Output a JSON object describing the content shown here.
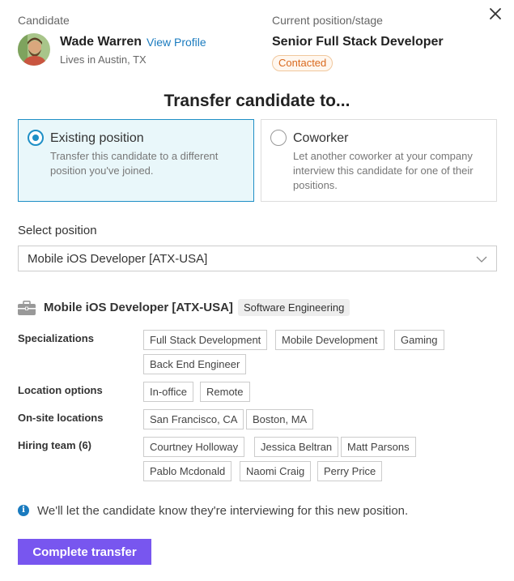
{
  "candidate": {
    "label": "Candidate",
    "name": "Wade Warren",
    "view_profile": "View Profile",
    "location": "Lives in Austin, TX"
  },
  "current": {
    "label": "Current position/stage",
    "title": "Senior Full Stack Developer",
    "stage": "Contacted"
  },
  "transfer": {
    "title": "Transfer candidate to...",
    "options": [
      {
        "title": "Existing position",
        "desc": "Transfer this candidate to a different position you've joined.",
        "selected": true
      },
      {
        "title": "Coworker",
        "desc": "Let another coworker at your company interview this candidate for one of their positions.",
        "selected": false
      }
    ]
  },
  "select": {
    "label": "Select position",
    "value": "Mobile iOS Developer [ATX-USA]"
  },
  "position": {
    "name": "Mobile iOS Developer [ATX-USA]",
    "department": "Software Engineering",
    "specializations_label": "Specializations",
    "specializations": [
      "Full Stack Development",
      "Mobile Development",
      "Gaming",
      "Back End Engineer"
    ],
    "location_options_label": "Location options",
    "location_options": [
      "In-office",
      "Remote"
    ],
    "onsite_label": "On-site locations",
    "onsite": [
      "San Francisco, CA",
      "Boston, MA"
    ],
    "hiring_team_label": "Hiring team (6)",
    "hiring_team": [
      "Courtney Holloway",
      "Jessica Beltran",
      "Matt Parsons",
      "Pablo Mcdonald",
      "Naomi Craig",
      "Perry Price"
    ]
  },
  "info": {
    "icon": "info-icon",
    "text": "We'll let the candidate know they're interviewing for this new position."
  },
  "actions": {
    "complete": "Complete transfer"
  },
  "colors": {
    "accent": "#7856ef",
    "link": "#1a7bbf",
    "selected_border": "#1e8fc6",
    "badge": "#d9691e"
  }
}
